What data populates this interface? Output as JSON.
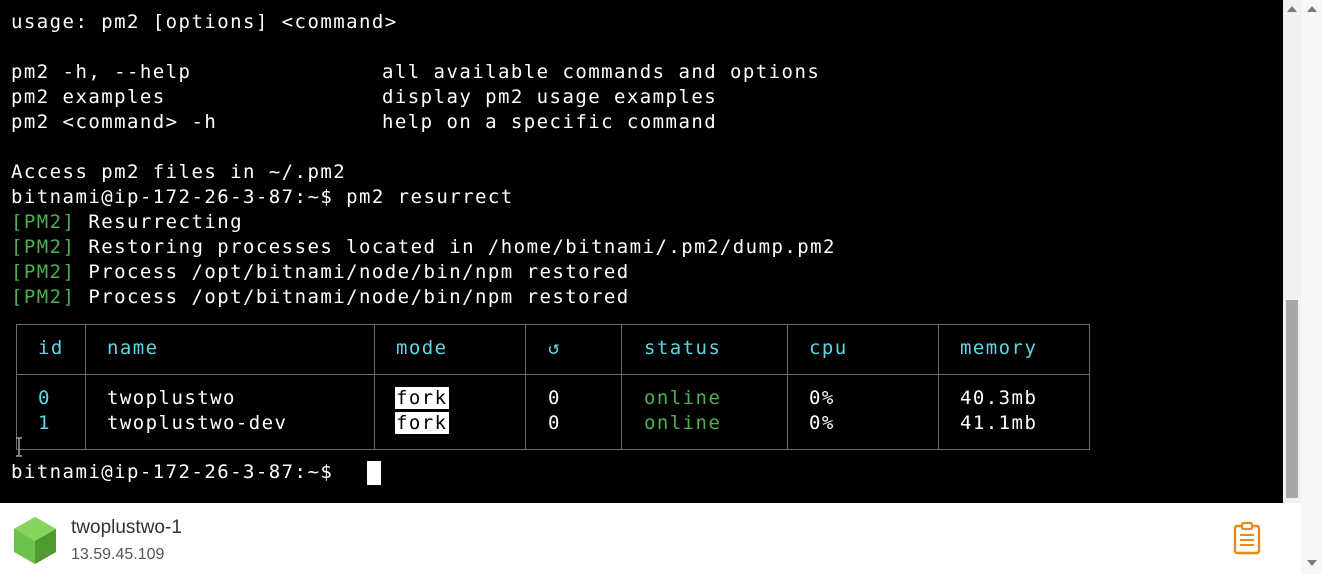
{
  "terminal": {
    "lines": [
      "usage: pm2 [options] <command>",
      "",
      "pm2 -h, --help",
      "pm2 examples",
      "pm2 <command> -h",
      "",
      "Access pm2 files in ~/.pm2",
      "bitnami@ip-172-26-3-87:~$ pm2 resurrect"
    ],
    "help_desc": [
      "all available commands and options",
      "display pm2 usage examples",
      "help on a specific command"
    ],
    "pm2_tag": "[PM2]",
    "pm2_msgs": [
      " Resurrecting",
      " Restoring processes located in /home/bitnami/.pm2/dump.pm2",
      " Process /opt/bitnami/node/bin/npm restored",
      " Process /opt/bitnami/node/bin/npm restored"
    ],
    "prompt": "bitnami@ip-172-26-3-87:~$ "
  },
  "table": {
    "headers": [
      "id",
      "name",
      "mode",
      "↺",
      "status",
      "cpu",
      "memory"
    ],
    "rows": [
      {
        "id": "0",
        "name": "twoplustwo",
        "mode": "fork",
        "restarts": "0",
        "status": "online",
        "cpu": "0%",
        "memory": "40.3mb"
      },
      {
        "id": "1",
        "name": "twoplustwo-dev",
        "mode": "fork",
        "restarts": "0",
        "status": "online",
        "cpu": "0%",
        "memory": "41.1mb"
      }
    ]
  },
  "footer": {
    "instance_name": "twoplustwo-1",
    "instance_ip": "13.59.45.109",
    "logo_icon": "node-hexagon-icon",
    "clipboard_icon": "clipboard-icon"
  },
  "colors": {
    "terminal_bg": "#000000",
    "pm2_green": "#4caf50",
    "header_cyan": "#5fd7e4",
    "clipboard_orange": "#e58a1f",
    "node_green": "#6cc24a"
  }
}
